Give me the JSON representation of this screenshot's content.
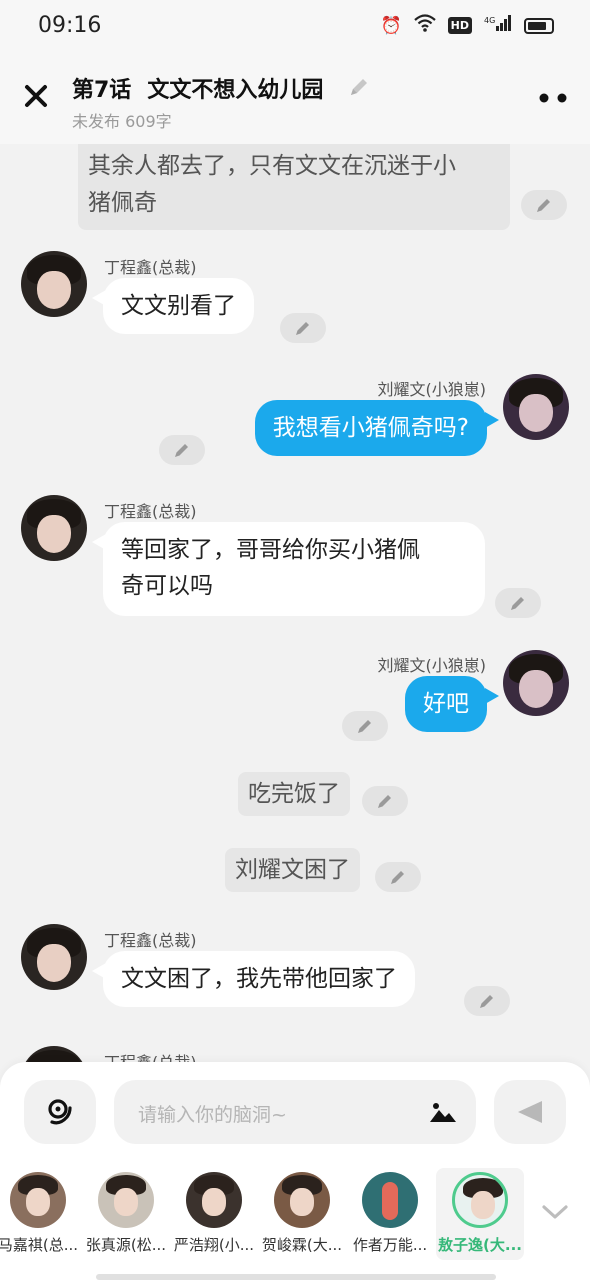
{
  "status_bar": {
    "time": "09:16",
    "hd": "HD",
    "network": "4G"
  },
  "header": {
    "episode": "第7话",
    "title": "文文不想入幼儿园",
    "status": "未发布",
    "word_count": "609字"
  },
  "messages": [
    {
      "type": "narration",
      "text_line1": "其余人都去了，只有文文在沉迷于小",
      "text_line2": "猪佩奇"
    },
    {
      "type": "left",
      "name": "丁程鑫(总裁)",
      "text": "文文别看了"
    },
    {
      "type": "right",
      "name": "刘耀文(小狼崽)",
      "text": "我想看小猪佩奇吗?"
    },
    {
      "type": "left",
      "name": "丁程鑫(总裁)",
      "text_line1": "等回家了，哥哥给你买小猪佩",
      "text_line2": "奇可以吗"
    },
    {
      "type": "right",
      "name": "刘耀文(小狼崽)",
      "text": "好吧"
    },
    {
      "type": "narration",
      "text": "吃完饭了"
    },
    {
      "type": "narration",
      "text": "刘耀文困了"
    },
    {
      "type": "left",
      "name": "丁程鑫(总裁)",
      "text": "文文困了，我先带他回家了"
    },
    {
      "type": "left",
      "name": "丁程鑫(总裁)",
      "text": ""
    }
  ],
  "input": {
    "placeholder": "请输入你的脑洞~"
  },
  "roles": [
    {
      "label": "马嘉祺(总..."
    },
    {
      "label": "张真源(松..."
    },
    {
      "label": "严浩翔(小..."
    },
    {
      "label": "贺峻霖(大..."
    },
    {
      "label": "作者万能..."
    },
    {
      "label": "敖子逸(大...",
      "selected": true
    }
  ],
  "colors": {
    "accent_blue": "#1ba9ec",
    "selected_green": "#36b879"
  }
}
